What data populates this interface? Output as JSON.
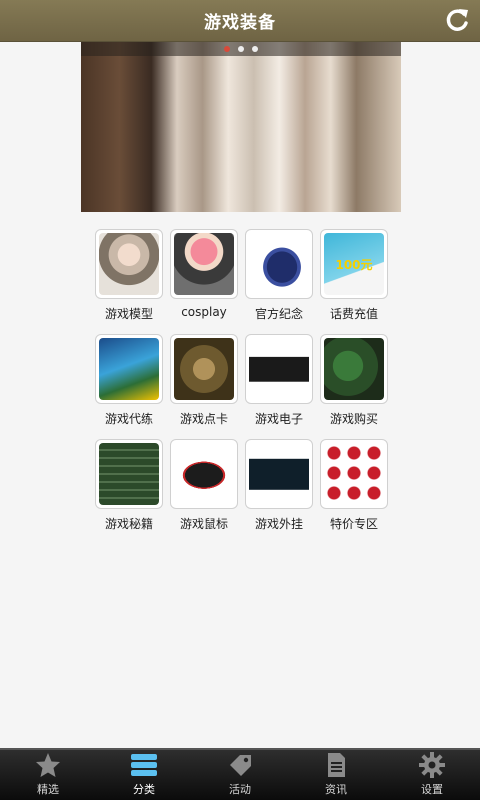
{
  "header": {
    "title": "游戏装备"
  },
  "banner": {
    "dot_count": 3,
    "active_dot": 0
  },
  "categories": [
    {
      "label": "游戏模型",
      "icon": "doll-image"
    },
    {
      "label": "cosplay",
      "icon": "cosplay-image"
    },
    {
      "label": "官方纪念",
      "icon": "cap-image"
    },
    {
      "label": "话费充值",
      "icon": "recharge-card-image"
    },
    {
      "label": "游戏代练",
      "icon": "leveling-image"
    },
    {
      "label": "游戏点卡",
      "icon": "game-card-image"
    },
    {
      "label": "游戏电子",
      "icon": "handheld-console-image"
    },
    {
      "label": "游戏购买",
      "icon": "game-screenshot-image"
    },
    {
      "label": "游戏秘籍",
      "icon": "cheat-list-image"
    },
    {
      "label": "游戏鼠标",
      "icon": "mouse-image"
    },
    {
      "label": "游戏外挂",
      "icon": "plugin-screenshot-image"
    },
    {
      "label": "特价专区",
      "icon": "sale-tags-image"
    }
  ],
  "recharge_badge": "100元",
  "tabs": [
    {
      "label": "精选",
      "icon": "star-icon"
    },
    {
      "label": "分类",
      "icon": "category-icon"
    },
    {
      "label": "活动",
      "icon": "tag-icon"
    },
    {
      "label": "资讯",
      "icon": "document-icon"
    },
    {
      "label": "设置",
      "icon": "gear-icon"
    }
  ],
  "active_tab": 1,
  "colors": {
    "header": "#7a6f4c",
    "tabbar": "#1a1a1a",
    "active_tab": "#5bc0f0"
  }
}
